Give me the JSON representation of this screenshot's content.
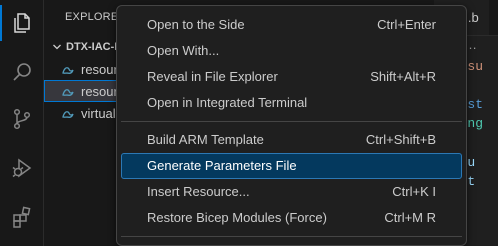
{
  "activity_bar": {
    "items": [
      {
        "icon": "files-icon",
        "active": true
      },
      {
        "icon": "search-icon",
        "active": false
      },
      {
        "icon": "source-control-icon",
        "active": false
      },
      {
        "icon": "run-debug-icon",
        "active": false
      },
      {
        "icon": "extensions-icon",
        "active": false
      }
    ]
  },
  "explorer": {
    "title": "EXPLORER",
    "folder": {
      "name": "DTX-IAC-I"
    },
    "files": [
      {
        "name": "resour",
        "selected": false
      },
      {
        "name": "resour",
        "selected": true
      },
      {
        "name": "virtual",
        "selected": false
      }
    ]
  },
  "editor": {
    "tab_label": "king.b",
    "breadcrumb": "…",
    "code_lines": [
      {
        "text": "= 'su",
        "color": "#ce9178"
      },
      {
        "text": "on st",
        "color": "#569cd6"
      },
      {
        "text": "tring",
        "color": "#4ec9b0"
      },
      {
        "text": "esou",
        "color": "#9cdcfe"
      },
      {
        "text": "ocat",
        "color": "#9cdcfe"
      }
    ]
  },
  "context_menu": {
    "groups": [
      [
        {
          "label": "Open to the Side",
          "shortcut": "Ctrl+Enter"
        },
        {
          "label": "Open With...",
          "shortcut": ""
        },
        {
          "label": "Reveal in File Explorer",
          "shortcut": "Shift+Alt+R"
        },
        {
          "label": "Open in Integrated Terminal",
          "shortcut": ""
        }
      ],
      [
        {
          "label": "Build ARM Template",
          "shortcut": "Ctrl+Shift+B"
        },
        {
          "label": "Generate Parameters File",
          "shortcut": "",
          "highlighted": true
        },
        {
          "label": "Insert Resource...",
          "shortcut": "Ctrl+K I"
        },
        {
          "label": "Restore Bicep Modules (Force)",
          "shortcut": "Ctrl+M R"
        }
      ]
    ]
  },
  "colors": {
    "accent": "#0078d4",
    "menu_highlight": "#04395e",
    "background": "#1f1f1f",
    "bicep_icon": "#519aba"
  }
}
